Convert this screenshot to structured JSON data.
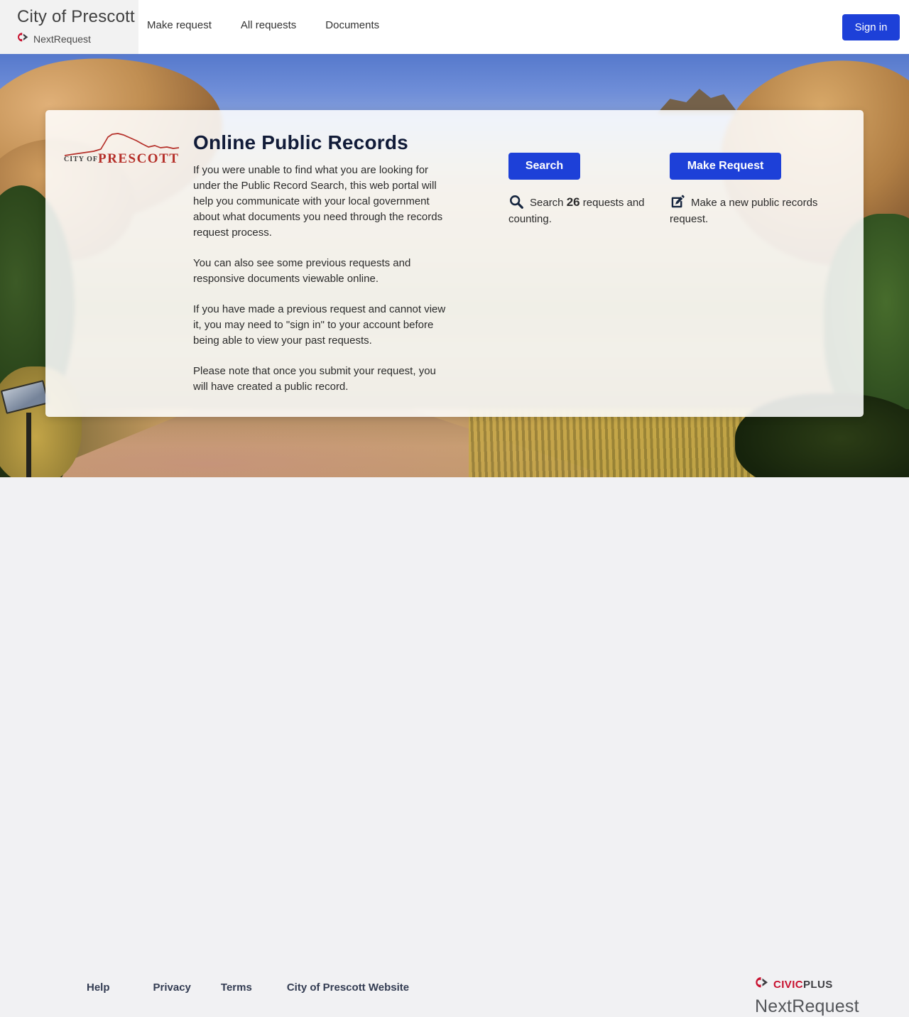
{
  "header": {
    "agency": "City of Prescott",
    "brand": "NextRequest",
    "nav": [
      {
        "label": "Make request"
      },
      {
        "label": "All requests"
      },
      {
        "label": "Documents"
      }
    ],
    "sign_in": "Sign in"
  },
  "card": {
    "logo": {
      "line1": "CITY OF",
      "line2": "PRESCOTT"
    },
    "title": "Online Public Records",
    "paragraphs": [
      "If you were unable to find what you are looking for under the Public Record Search, this web portal will help you communicate with your local government about what documents you need through the records request process.",
      "You can also see some previous requests and responsive documents viewable online.",
      "If you have made a previous request and cannot view it, you may need to \"sign in\" to your account before being able to view your past requests.",
      "Please note that once you submit your request, you will have created a public record."
    ],
    "actions": {
      "search": {
        "button": "Search",
        "desc_prefix": "Search ",
        "count": "26",
        "desc_suffix": " requests and counting."
      },
      "make": {
        "button": "Make Request",
        "desc": "Make a new public records request."
      }
    }
  },
  "footer": {
    "links": [
      "Help",
      "Privacy",
      "Terms",
      "City of Prescott Website"
    ],
    "civic": "CIVIC",
    "plus": "PLUS",
    "brand": "NextRequest"
  },
  "colors": {
    "accent_blue": "#1d40d8",
    "civic_red": "#c8102e",
    "heading_navy": "#111b38",
    "footer_bg": "#f1f1f3"
  }
}
